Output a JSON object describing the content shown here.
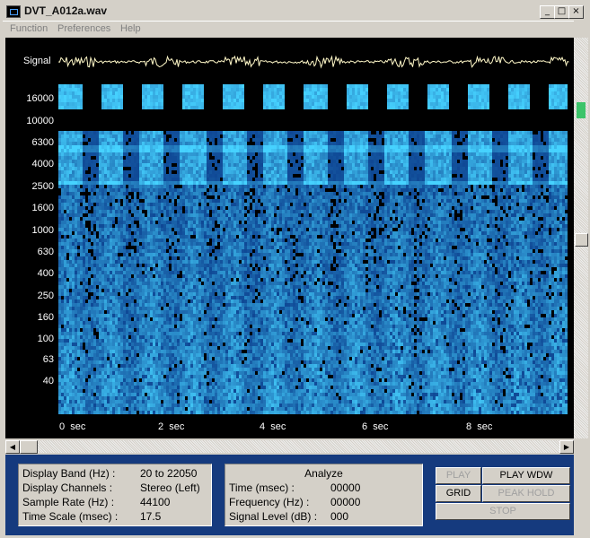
{
  "window": {
    "title": "DVT_A012a.wav",
    "buttons": {
      "minimize": "_",
      "maximize": "□",
      "close": "×"
    }
  },
  "menu": [
    "Function",
    "Preferences",
    "Help"
  ],
  "signal_label": "Signal",
  "frequency_labels": [
    "16000",
    "10000",
    "6300",
    "4000",
    "2500",
    "1600",
    "1000",
    "630",
    "400",
    "250",
    "160",
    "100",
    "63",
    "40"
  ],
  "time_labels": [
    "0  sec",
    "2  sec",
    "4  sec",
    "6  sec",
    "8  sec"
  ],
  "info": {
    "display_band_label": "Display Band (Hz) :",
    "display_band_value": "20 to 22050",
    "display_channels_label": "Display Channels :",
    "display_channels_value": "Stereo (Left)",
    "sample_rate_label": "Sample Rate (Hz) :",
    "sample_rate_value": "44100",
    "time_scale_label": "Time Scale (msec) :",
    "time_scale_value": "17.5"
  },
  "analyze": {
    "title": "Analyze",
    "time_label": "Time (msec) :",
    "time_value": "00000",
    "frequency_label": "Frequency (Hz) :",
    "frequency_value": "00000",
    "signal_level_label": "Signal Level (dB) :",
    "signal_level_value": "000"
  },
  "buttons": {
    "play": "PLAY",
    "play_wdw": "PLAY WDW",
    "grid": "GRID",
    "peak_hold": "PEAK HOLD",
    "stop": "STOP"
  },
  "colors": {
    "panel_blue": "#153a7e",
    "spectrogram_bright": "#4aa8ff",
    "signal_wave": "#fff8c8"
  }
}
